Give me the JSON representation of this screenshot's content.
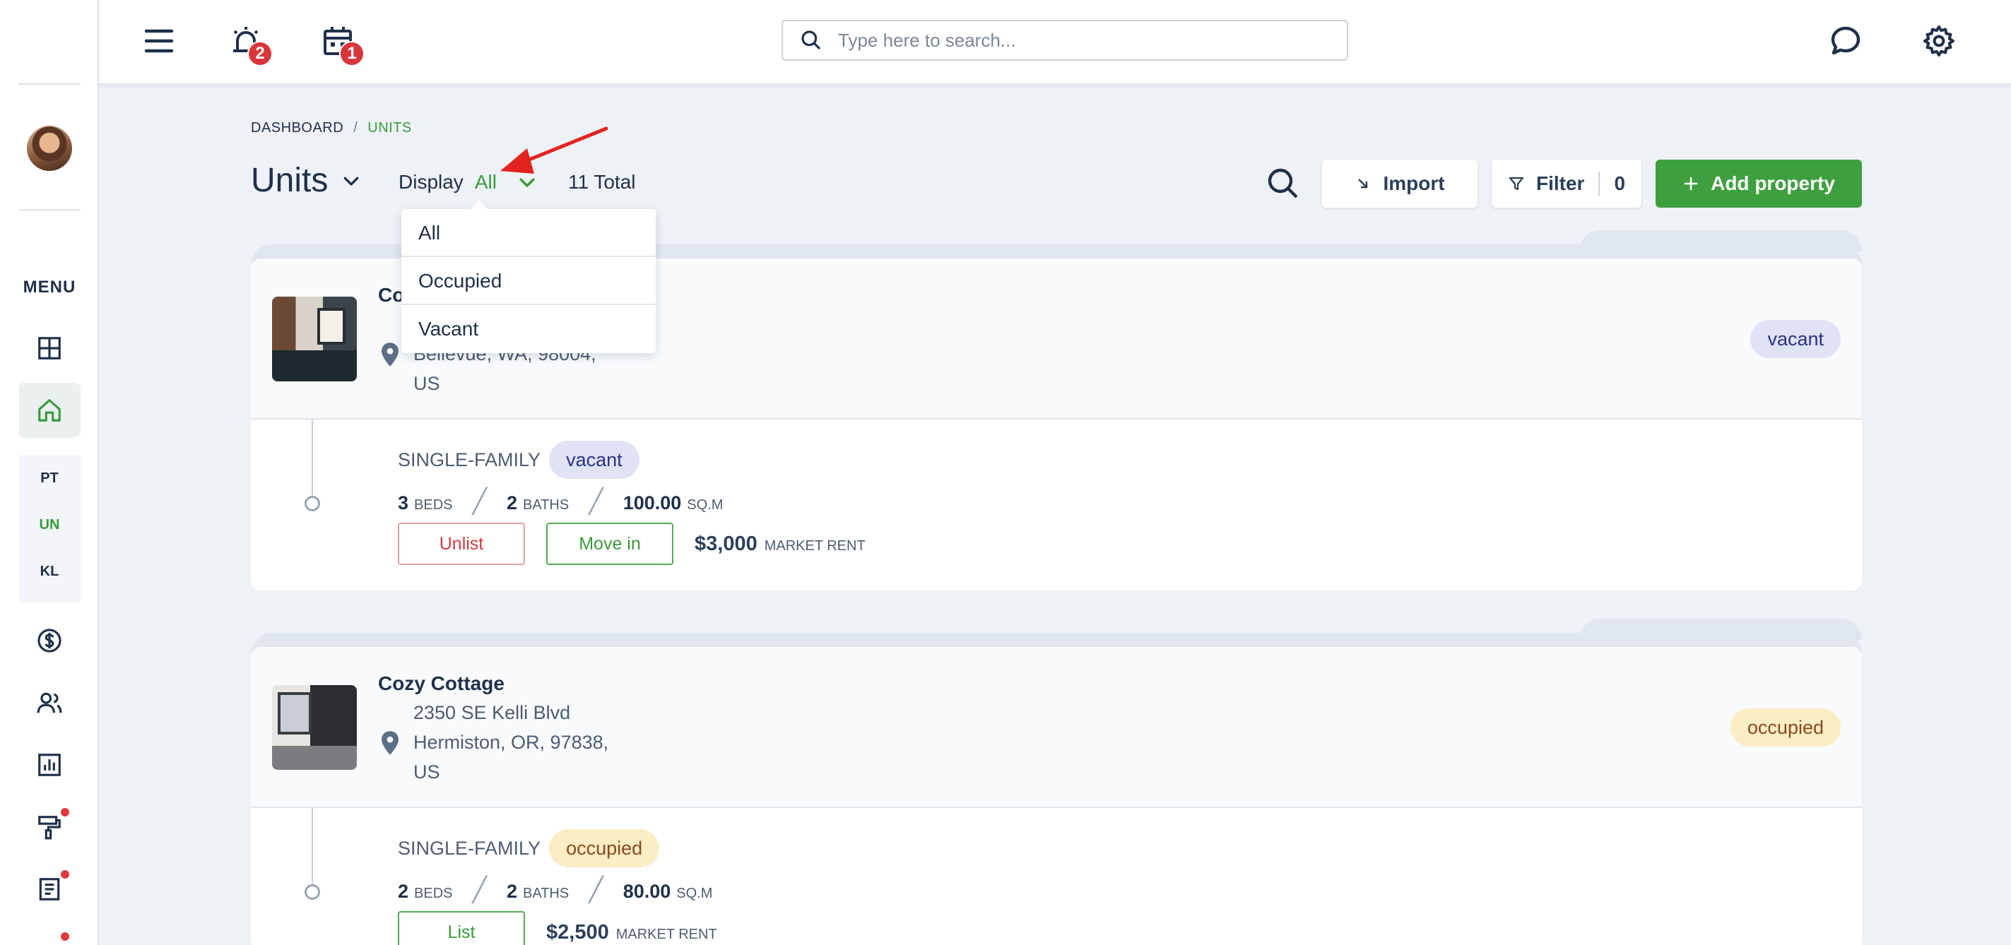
{
  "sidebar": {
    "menu_label": "MENU",
    "sub_items": [
      {
        "label": "PT",
        "active": false
      },
      {
        "label": "UN",
        "active": true
      },
      {
        "label": "KL",
        "active": false
      }
    ]
  },
  "topbar": {
    "notifications_badge": "2",
    "calendar_badge": "1",
    "search_placeholder": "Type here to search..."
  },
  "breadcrumb": {
    "root": "DASHBOARD",
    "separator": "/",
    "current": "UNITS"
  },
  "header": {
    "title": "Units",
    "display_label": "Display",
    "display_value": "All",
    "total": "11 Total",
    "import_label": "Import",
    "filter_label": "Filter",
    "filter_count": "0",
    "add_label": "Add property"
  },
  "dropdown": {
    "options": [
      "All",
      "Occupied",
      "Vacant"
    ]
  },
  "properties": [
    {
      "name": "Co",
      "address_lines": [
        "Bellevue, WA, 98004,",
        "US"
      ],
      "status": "vacant",
      "unit": {
        "type": "SINGLE-FAMILY",
        "status": "vacant",
        "beds": "3",
        "beds_label": "BEDS",
        "baths": "2",
        "baths_label": "BATHS",
        "area": "100.00",
        "area_label": "SQ.M",
        "btn_primary": "Unlist",
        "btn_secondary": "Move in",
        "rent": "$3,000",
        "rent_label": "MARKET RENT"
      }
    },
    {
      "name": "Cozy Cottage",
      "address_lines": [
        "2350 SE Kelli Blvd",
        "Hermiston, OR, 97838,",
        "US"
      ],
      "status": "occupied",
      "unit": {
        "type": "SINGLE-FAMILY",
        "status": "occupied",
        "beds": "2",
        "beds_label": "BEDS",
        "baths": "2",
        "baths_label": "BATHS",
        "area": "80.00",
        "area_label": "SQ.M",
        "btn_primary": "List",
        "rent": "$2,500",
        "rent_label": "MARKET RENT"
      }
    }
  ],
  "colors": {
    "accent_green": "#3e9f3f",
    "danger_red": "#d9363b",
    "text_navy": "#1f3049"
  }
}
